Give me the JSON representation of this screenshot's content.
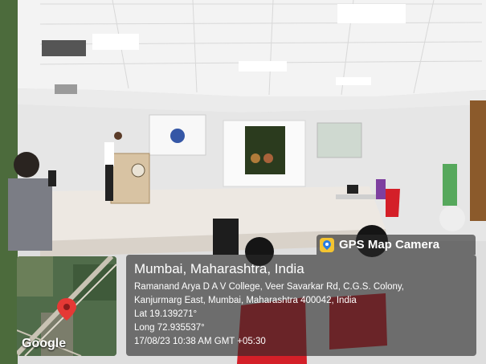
{
  "badge": {
    "text": "GPS Map Camera",
    "icon": "map-pin-icon"
  },
  "map": {
    "brand": "Google"
  },
  "location": {
    "title": "Mumbai, Maharashtra, India",
    "address_line1": "Ramanand Arya D A V College, Veer Savarkar Rd, C.G.S. Colony,",
    "address_line2": "Kanjurmarg East, Mumbai, Maharashtra 400042, India",
    "lat": "Lat 19.139271°",
    "long": "Long 72.935537°",
    "timestamp": "17/08/23 10:38 AM GMT +05:30"
  },
  "colors": {
    "overlay": "#282828",
    "ceiling": "#f3f3f3",
    "stage": "#ede8e2",
    "chair": "#d41f28",
    "marker": "#e53935"
  }
}
